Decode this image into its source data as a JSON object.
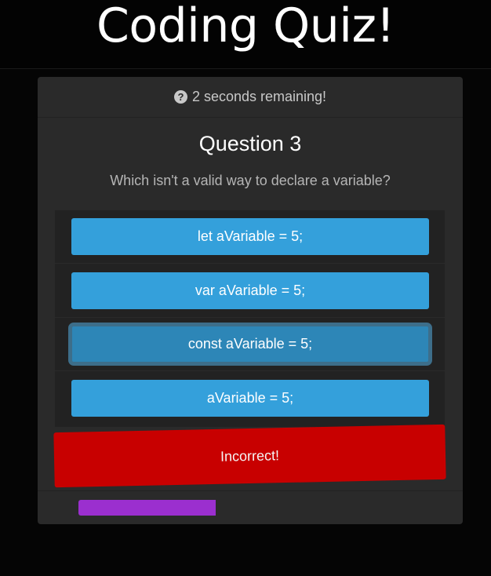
{
  "header": {
    "title": "Coding Quiz!"
  },
  "timer": {
    "icon": "question-circle-icon",
    "text": "2 seconds remaining!"
  },
  "question": {
    "title": "Question 3",
    "text": "Which isn't a valid way to declare a variable?"
  },
  "answers": [
    {
      "label": "let aVariable = 5;"
    },
    {
      "label": "var aVariable = 5;"
    },
    {
      "label": "const aVariable = 5;"
    },
    {
      "label": "aVariable = 5;"
    }
  ],
  "selected_answer_index": 2,
  "feedback": {
    "text": "Incorrect!",
    "color": "#c80000"
  },
  "progress": {
    "fraction": 0.4,
    "color": "#9b2fcf"
  },
  "colors": {
    "answer_button": "#34a0db",
    "answer_selected": "#2d86b7",
    "card": "#2a2a2a",
    "background": "#050505"
  }
}
